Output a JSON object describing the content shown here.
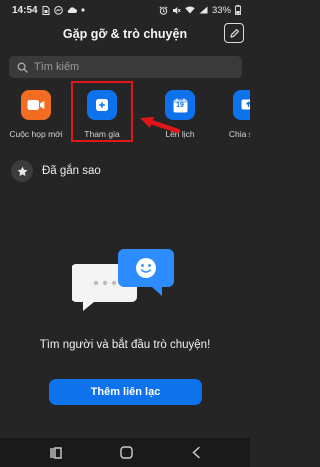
{
  "status_bar": {
    "time": "14:54",
    "battery": "33%",
    "left_icons": [
      "sim-icon",
      "messenger-icon",
      "cloud-icon",
      "dot-icon"
    ],
    "right_icons": [
      "alarm-icon",
      "mute-icon",
      "wifi-icon",
      "signal-icon",
      "battery-icon"
    ]
  },
  "header": {
    "title": "Gặp gỡ & trò chuyện",
    "edit_icon": "edit-icon"
  },
  "search": {
    "placeholder": "Tìm kiếm",
    "icon": "search-icon"
  },
  "actions": [
    {
      "label": "Cuộc họp mới",
      "icon": "video-camera-icon",
      "color": "#f26d21"
    },
    {
      "label": "Tham gia",
      "icon": "plus-icon",
      "color": "#0e72ed"
    },
    {
      "label": "Lên lịch",
      "icon": "calendar-icon",
      "color": "#0e72ed",
      "date": "19"
    },
    {
      "label": "Chia sẻ m",
      "icon": "share-screen-icon",
      "color": "#0e72ed"
    }
  ],
  "annotation": {
    "highlight_color": "#e0161b",
    "highlighted_item": "Tham gia"
  },
  "starred": {
    "label": "Đã gắn sao",
    "icon": "star-icon"
  },
  "empty_state": {
    "icon": "chat-bubbles-icon",
    "message": "Tìm người và bắt đầu trò chuyện!"
  },
  "add_contact": {
    "label": "Thêm liên lạc"
  },
  "nav_bar": {
    "icons": [
      "recent-apps-icon",
      "home-icon",
      "back-icon"
    ]
  },
  "colors": {
    "background": "#252525",
    "accent": "#0e72ed",
    "orange": "#f26d21"
  }
}
